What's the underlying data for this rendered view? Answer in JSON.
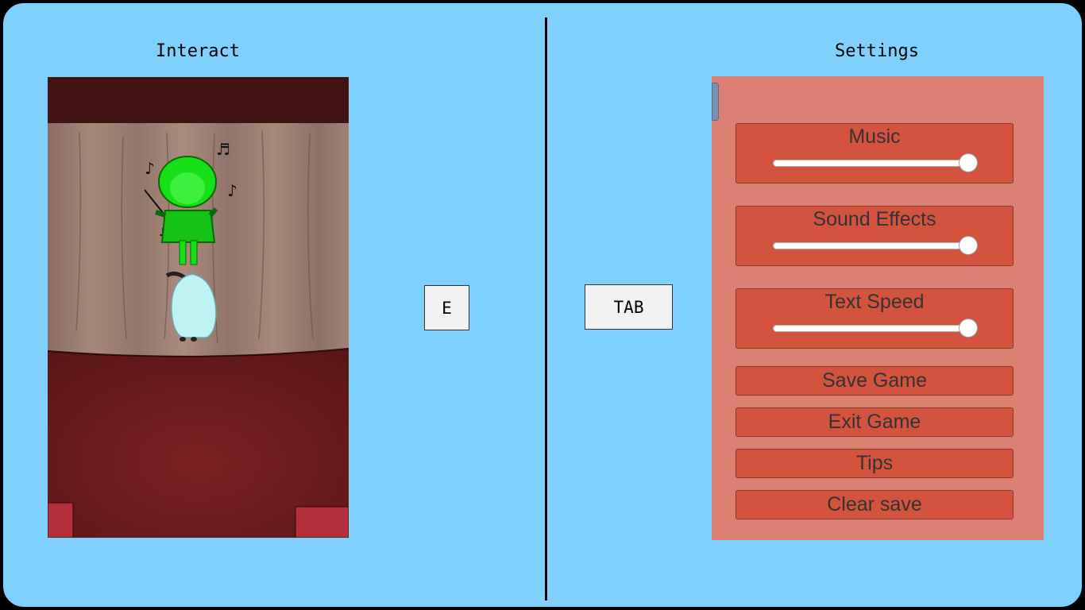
{
  "left_section": {
    "title": "Interact",
    "key_label": "E"
  },
  "right_section": {
    "title": "Settings",
    "key_label": "TAB"
  },
  "scene": {
    "description_icon": "stage-scene"
  },
  "settings": {
    "sliders": [
      {
        "label": "Music",
        "value": 1.0
      },
      {
        "label": "Sound Effects",
        "value": 1.0
      },
      {
        "label": "Text Speed",
        "value": 1.0
      }
    ],
    "buttons": [
      {
        "label": "Save Game"
      },
      {
        "label": "Exit Game"
      },
      {
        "label": "Tips"
      },
      {
        "label": "Clear save"
      }
    ]
  },
  "colors": {
    "background": "#80d0fe",
    "panel": "#da8174",
    "control": "#d3533e",
    "composer_highlight": "#16e016"
  }
}
